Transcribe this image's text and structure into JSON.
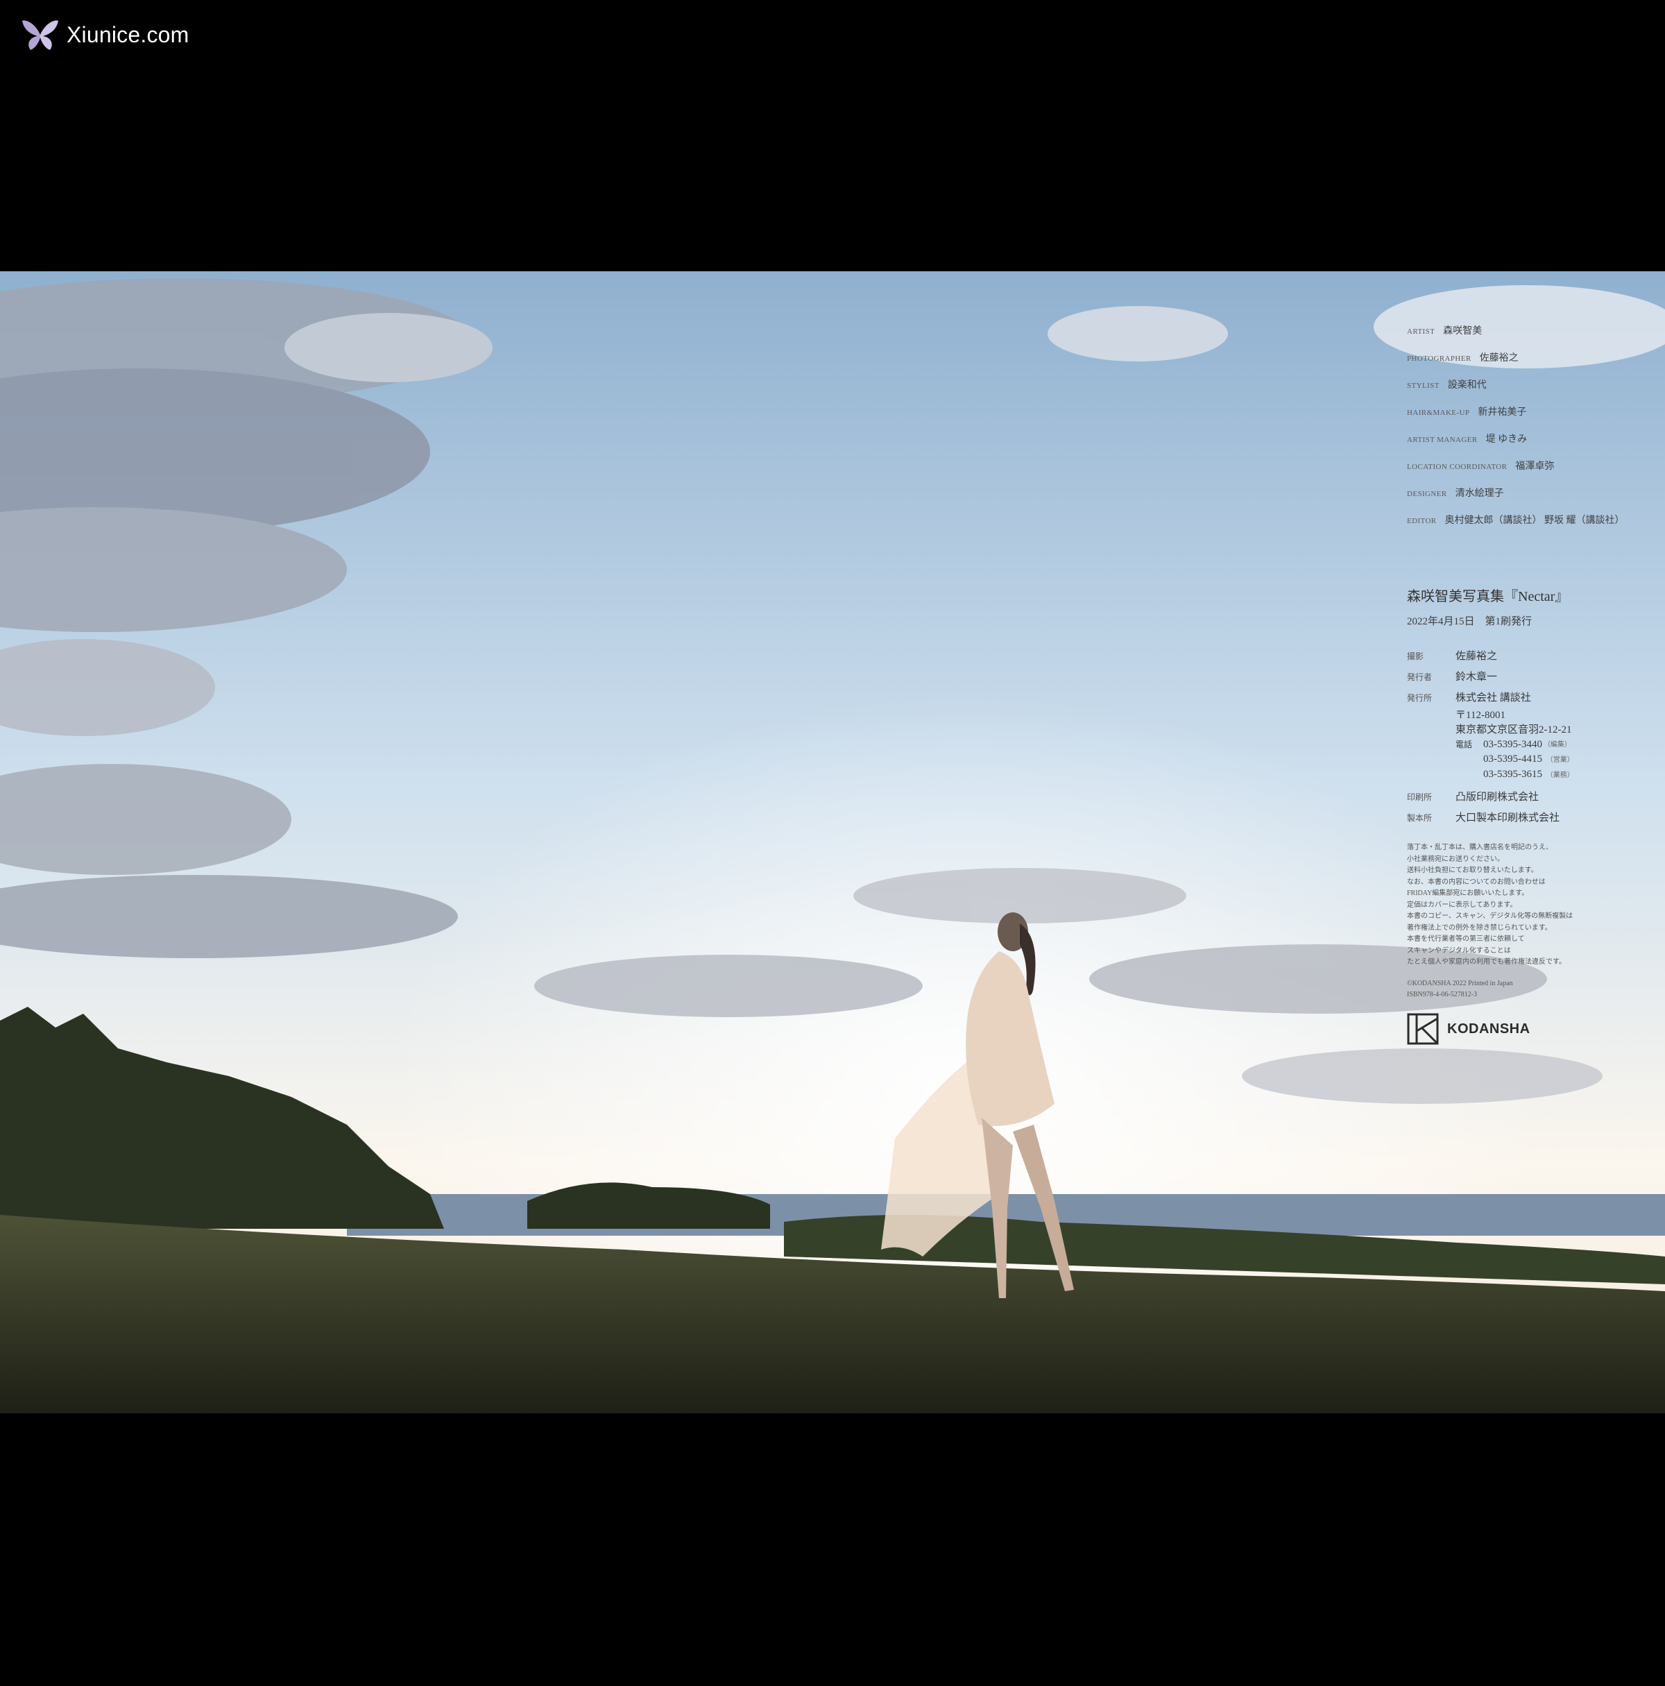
{
  "watermark": {
    "text": "Xiunice.com",
    "icon": "butterfly-icon"
  },
  "colors": {
    "sky_top": "#8fb0cf",
    "sky_bottom": "#fbf6ee",
    "cloud": "#9aa3b2",
    "ground": "#2f3222",
    "sea": "#6f86a0",
    "background": "#000000"
  },
  "credits": [
    {
      "role": "ARTIST",
      "name": "森咲智美"
    },
    {
      "role": "PHOTOGRAPHER",
      "name": "佐藤裕之"
    },
    {
      "role": "STYLIST",
      "name": "設楽和代"
    },
    {
      "role": "HAIR&MAKE-UP",
      "name": "新井祐美子"
    },
    {
      "role": "ARTIST MANAGER",
      "name": "堤 ゆきみ"
    },
    {
      "role": "LOCATION COORDINATOR",
      "name": "福澤卓弥"
    },
    {
      "role": "DESIGNER",
      "name": "清水絵理子"
    },
    {
      "role": "EDITOR",
      "name": "奥村健太郎（講談社） 野坂 耀（講談社）"
    }
  ],
  "book": {
    "title": "森咲智美写真集『Nectar』",
    "date": "2022年4月15日　第1刷発行",
    "photographer_label": "撮影",
    "photographer": "佐藤裕之",
    "publisher_person_label": "発行者",
    "publisher_person": "鈴木章一",
    "publisher_label": "発行所",
    "publisher": "株式会社 講談社",
    "postal": "〒112-8001",
    "address": "東京都文京区音羽2-12-21",
    "tel_label": "電話",
    "tel_1": "03-5395-3440",
    "tel_1_note": "（編集）",
    "tel_2": "03-5395-4415",
    "tel_2_note": "（営業）",
    "tel_3": "03-5395-3615",
    "tel_3_note": "（業務）",
    "printer_label": "印刷所",
    "printer": "凸版印刷株式会社",
    "binder_label": "製本所",
    "binder": "大口製本印刷株式会社",
    "notes": [
      "落丁本・乱丁本は、購入書店名を明記のうえ、",
      "小社業務宛にお送りください。",
      "送料小社負担にてお取り替えいたします。",
      "なお、本書の内容についてのお問い合わせは",
      "FRIDAY編集部宛にお願いいたします。",
      "定価はカバーに表示してあります。",
      "本書のコピー、スキャン、デジタル化等の無断複製は",
      "著作権法上での例外を除き禁じられています。",
      "本書を代行業者等の第三者に依頼して",
      "スキャンやデジタル化することは",
      "たとえ個人や家庭内の利用でも著作権法違反です。"
    ],
    "copyright": "©KODANSHA 2022 Printed in Japan",
    "isbn": "ISBN978-4-06-527812-3"
  },
  "publisher_logo": {
    "text": "KODANSHA",
    "icon": "kodansha-logo-icon"
  }
}
